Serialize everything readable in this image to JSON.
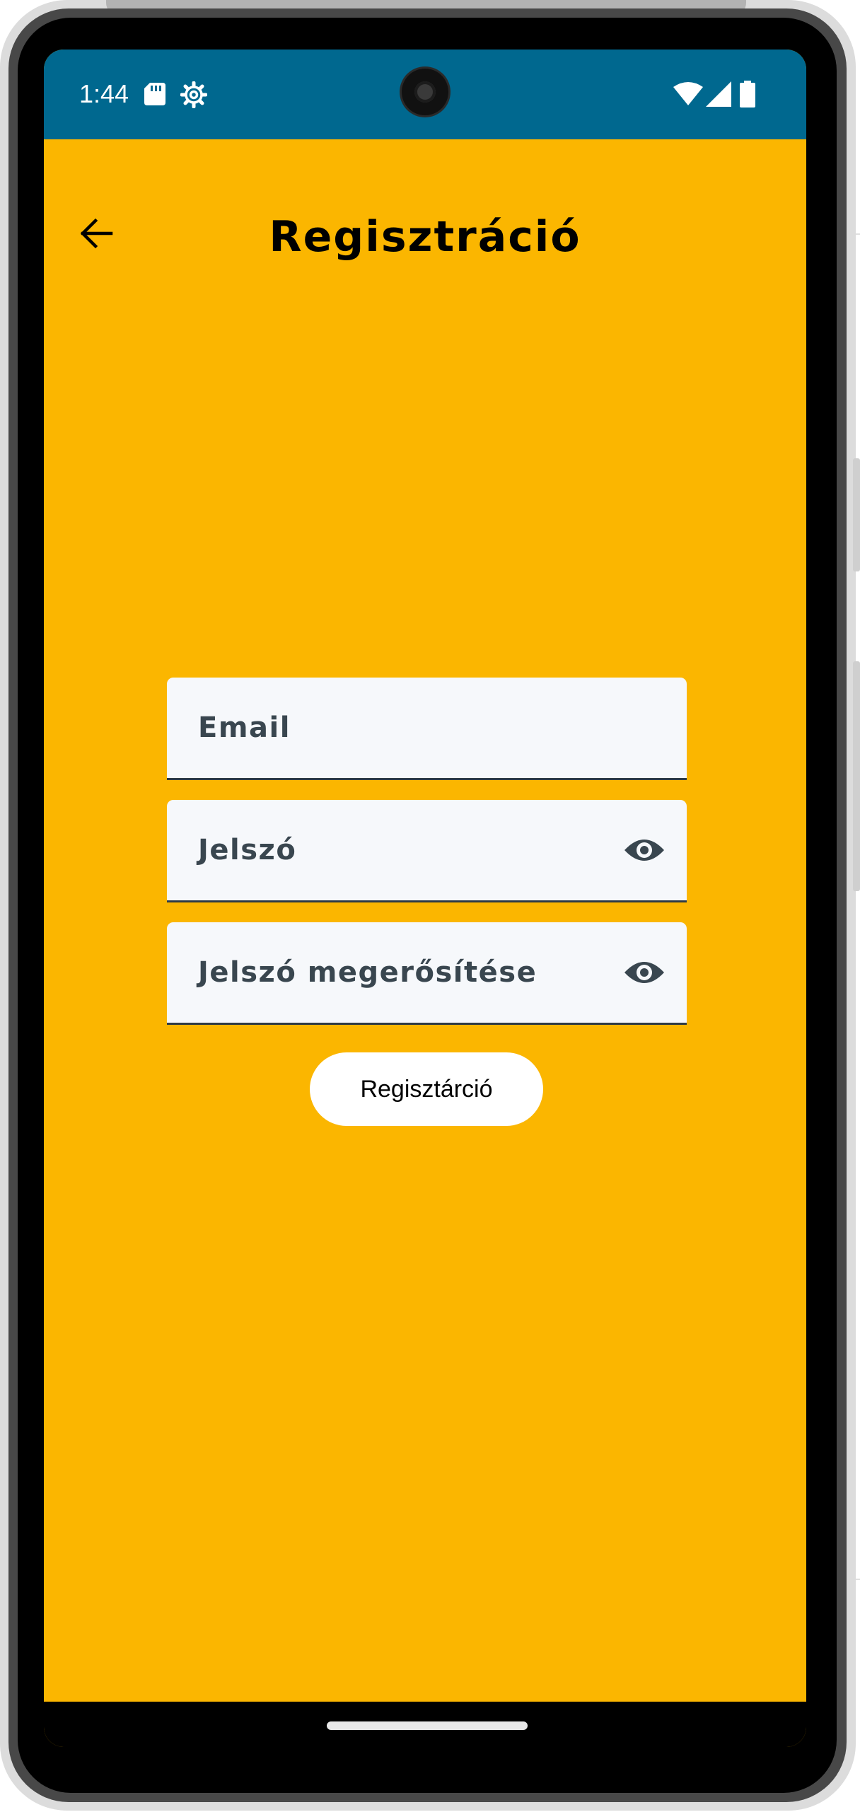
{
  "status_bar": {
    "time": "1:44",
    "background_color": "#00688F",
    "icons": [
      "sd-card-icon",
      "gear-icon",
      "wifi-icon",
      "signal-icon",
      "battery-icon"
    ]
  },
  "app_bar": {
    "title": "Regisztráció",
    "back_icon": "arrow-left-icon"
  },
  "form": {
    "email_label": "Email",
    "password_label": "Jelszó",
    "confirm_password_label": "Jelszó megerősítése",
    "visibility_icon": "eye-icon"
  },
  "submit_button": {
    "label": "Regisztárció"
  },
  "colors": {
    "screen_background": "#FBB600",
    "field_background": "#F6F8FB",
    "field_text": "#39464F",
    "button_background": "#FFFFFF"
  }
}
